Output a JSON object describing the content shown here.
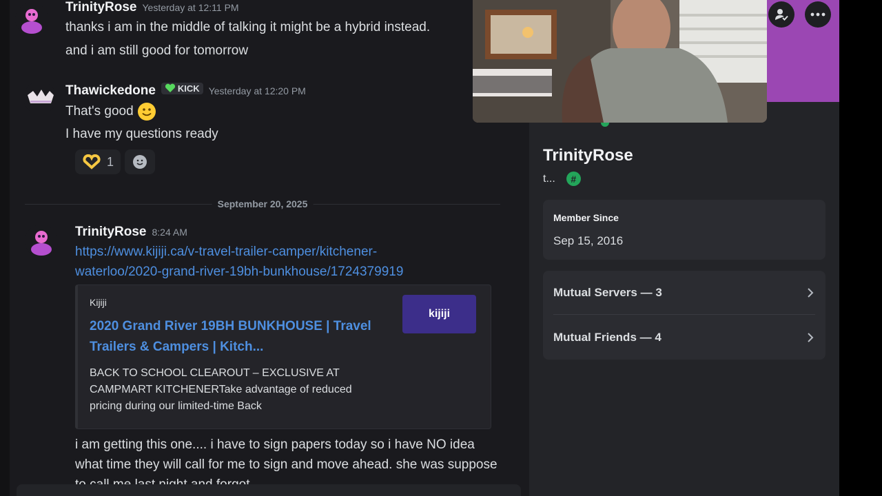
{
  "messages": [
    {
      "username": "TrinityRose",
      "timestamp": "Yesterday at 12:11 PM",
      "lines": [
        "thanks i am in the middle of talking it might be a hybrid instead.",
        "and i am still good for tomorrow"
      ]
    },
    {
      "username": "Thawickedone",
      "tag": "KICK",
      "timestamp": "Yesterday at 12:20 PM",
      "lines": [
        "That's good",
        "I have my questions ready"
      ],
      "reaction_count": "1"
    }
  ],
  "date_divider": "September 20, 2025",
  "message3": {
    "username": "TrinityRose",
    "timestamp": "8:24 AM",
    "link_line1": "https://www.kijiji.ca/v-travel-trailer-camper/kitchener-",
    "link_line2": "waterloo/2020-grand-river-19bh-bunkhouse/1724379919",
    "embed": {
      "provider": "Kijiji",
      "title": "2020 Grand River 19BH BUNKHOUSE | Travel Trailers & Campers | Kitch...",
      "description": "BACK TO SCHOOL CLEAROUT – EXCLUSIVE AT CAMPMART KITCHENERTake advantage of reduced pricing during our limited-time Back",
      "thumb_text": "kijiji"
    },
    "followup": "i am getting this one.... i have to sign papers today so i have NO idea what time they will call for me to sign and move ahead. she was suppose to call me last night and forgot"
  },
  "profile": {
    "name": "TrinityRose",
    "sub": "t...",
    "badge": "#",
    "member_since_label": "Member Since",
    "member_since_value": "Sep 15, 2016",
    "mutual_servers": "Mutual Servers — 3",
    "mutual_friends": "Mutual Friends — 4"
  },
  "colors": {
    "banner": "#9b47b3",
    "link": "#4e8fe0",
    "online": "#23a55a"
  }
}
